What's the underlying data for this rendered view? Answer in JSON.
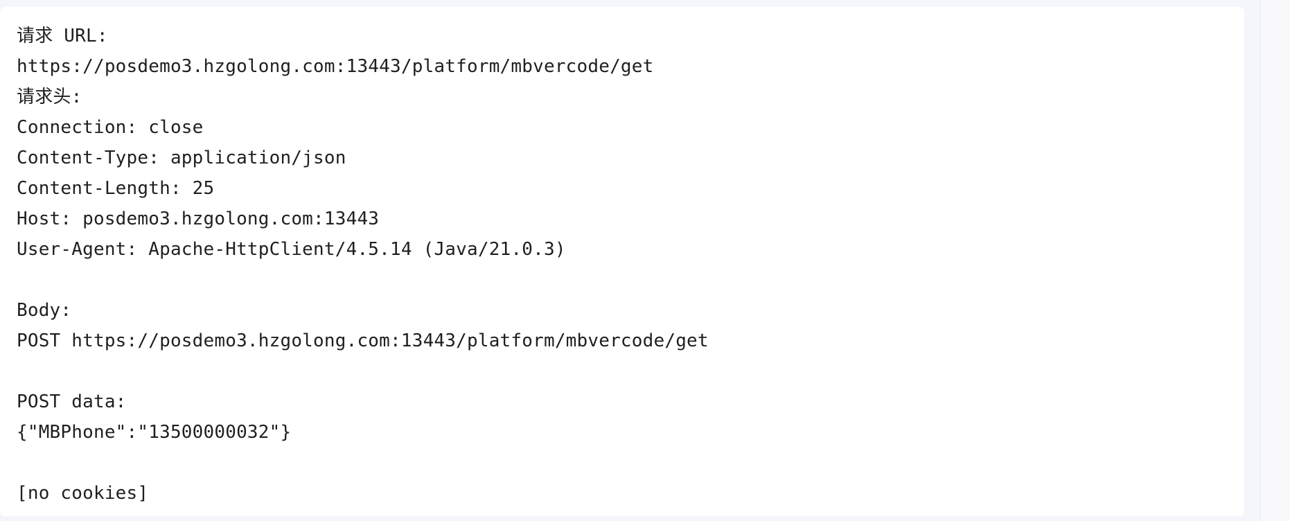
{
  "request": {
    "url_label": "请求 URL:",
    "url": "https://posdemo3.hzgolong.com:13443/platform/mbvercode/get",
    "headers_label": "请求头:",
    "headers": [
      "Connection: close",
      "Content-Type: application/json",
      "Content-Length: 25",
      "Host: posdemo3.hzgolong.com:13443",
      "User-Agent: Apache-HttpClient/4.5.14 (Java/21.0.3)"
    ],
    "body_label": "Body:",
    "body_line": "POST https://posdemo3.hzgolong.com:13443/platform/mbvercode/get",
    "post_data_label": "POST data:",
    "post_data": "{\"MBPhone\":\"13500000032\"}",
    "cookies": "[no cookies]"
  },
  "colors": {
    "background": "#f5f6fb",
    "panel": "#ffffff",
    "text": "#1f1f1f"
  }
}
